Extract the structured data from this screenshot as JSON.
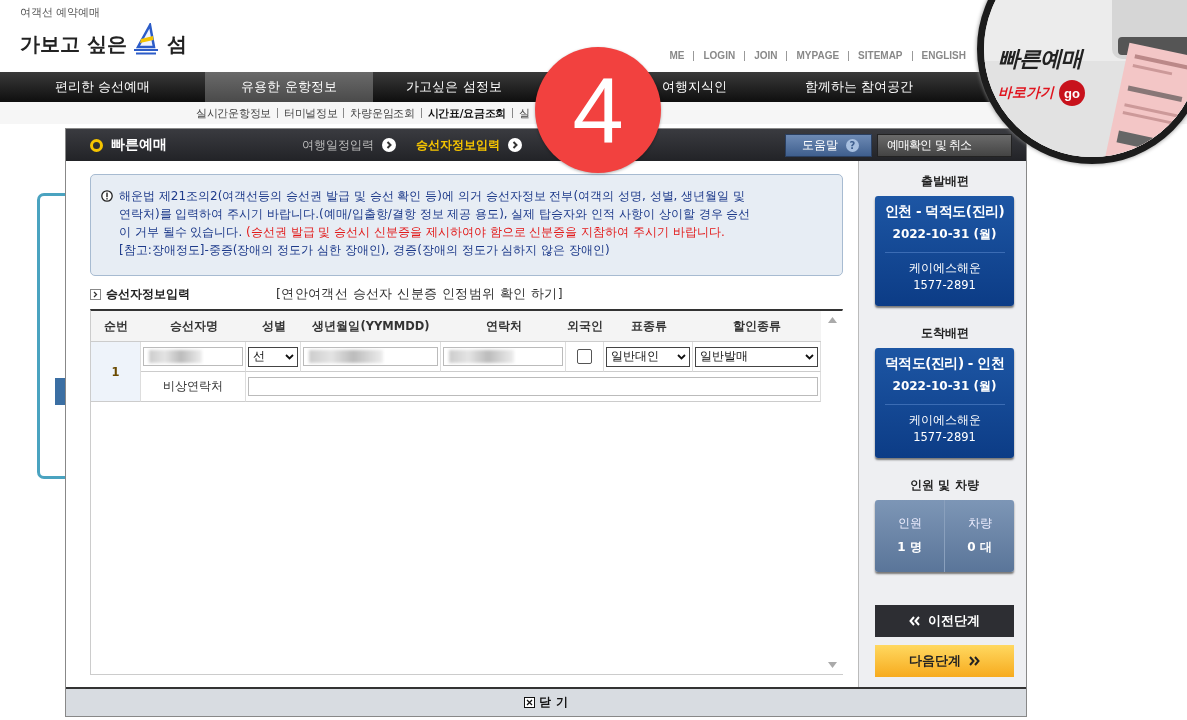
{
  "header": {
    "tagline": "여객선 예약예매",
    "logo_text": "가보고 싶은",
    "logo_end": "섬"
  },
  "top_links": [
    "ME",
    "LOGIN",
    "JOIN",
    "MYPAGE",
    "SITEMAP",
    "ENGLISH"
  ],
  "nav": [
    {
      "label": "편리한 승선예매",
      "selected": false
    },
    {
      "label": "유용한 운항정보",
      "selected": true
    },
    {
      "label": "가고싶은 섬정보",
      "selected": false
    },
    {
      "label": "여행지식인",
      "selected": false
    },
    {
      "label": "함께하는 참여공간",
      "selected": false
    }
  ],
  "sub_nav": [
    {
      "label": "실시간운항정보",
      "selected": false
    },
    {
      "label": "터미널정보",
      "selected": false
    },
    {
      "label": "차량운임조회",
      "selected": false
    },
    {
      "label": "시간표/요금조회",
      "selected": true
    },
    {
      "label": "실",
      "selected": false
    }
  ],
  "step_badge": "4",
  "quick_banner": {
    "title": "빠른예매",
    "link": "바로가기",
    "go": "go"
  },
  "modal": {
    "title": "빠른예매",
    "steps": [
      {
        "label": "여행일정입력",
        "selected": false
      },
      {
        "label": "승선자정보입력",
        "selected": true
      }
    ],
    "help_button": "도움말",
    "help_icon": "?",
    "confirm_button": "예매확인 및 취소",
    "notice": [
      {
        "segments": [
          {
            "kind": "normal",
            "text": "해운법 제21조의2(여객선등의 승선권 발급 및 승선 확인 등)에 의거 승선자정보 전부(여객의 성명, 성별, 생년월일 및 연락처)를 입력하여 주시기 바랍니다.(예매/입출항/결항 정보 제공 용도), 실제 탑승자와 인적 사항이 상이할 경우 승선이 거부 될수 있습니다. "
          },
          {
            "kind": "warning",
            "text": "(승선권 발급 및 승선시 신분증을 제시하여야 함으로 신분증을 지참하여 주시기 바랍니다."
          }
        ]
      },
      {
        "segments": [
          {
            "kind": "normal",
            "text": "[참고:장애정도]-중증(장애의 정도가 심한 장애인), 경증(장애의 정도가 심하지 않은 장애인)"
          }
        ]
      }
    ],
    "section_title": "승선자정보입력",
    "id_link": "[연안여객선 승선자 신분증 인정범위 확인 하기]",
    "columns": [
      "순번",
      "승선자명",
      "성별",
      "생년월일(YYMMDD)",
      "연락처",
      "외국인",
      "표종류",
      "할인종류"
    ],
    "rows": [
      {
        "number": "1",
        "gender": "선",
        "foreigner": {
          "checked": false
        },
        "ticket_type": "일반대인",
        "discount": "일반발매",
        "emergency_label": "비상연락처"
      }
    ],
    "close_button": "닫 기"
  },
  "sidebar": {
    "trips": [
      {
        "heading": "출발배편",
        "route": "인천 - 덕적도(진리)",
        "date": "2022-10-31 (월)",
        "company": "케이에스해운",
        "phone": "1577-2891"
      },
      {
        "heading": "도착배편",
        "route": "덕적도(진리) - 인천",
        "date": "2022-10-31 (월)",
        "company": "케이에스해운",
        "phone": "1577-2891"
      }
    ],
    "counts_heading": "인원 및 차량",
    "counts": [
      {
        "label": "인원",
        "value": "1 명"
      },
      {
        "label": "차량",
        "value": "0 대"
      }
    ],
    "prev_button": "이전단계",
    "next_button": "다음단계"
  }
}
